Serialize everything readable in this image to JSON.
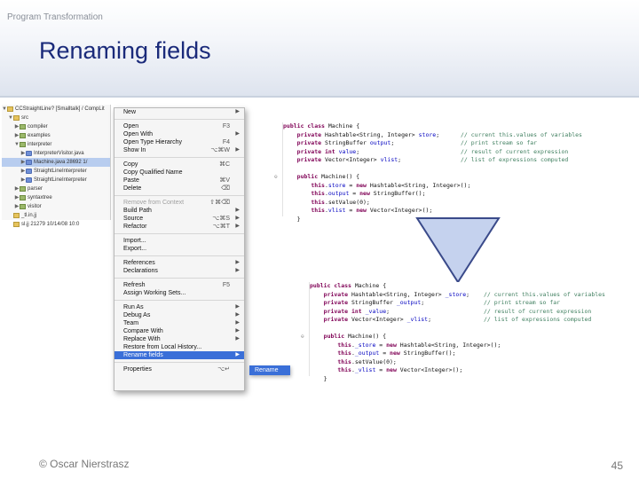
{
  "slide": {
    "course_label": "Program Transformation",
    "title": "Renaming fields",
    "copyright": "© Oscar Nierstrasz",
    "page_number": "45"
  },
  "explorer": {
    "items": [
      {
        "label": "CCStraightLine? [Smalltalk] / CompLit",
        "indent": 0,
        "twisty": "▼",
        "icon": "folder-icon",
        "selected": false
      },
      {
        "label": "src",
        "indent": 1,
        "twisty": "▼",
        "icon": "folder-icon",
        "selected": false
      },
      {
        "label": "compiler",
        "indent": 2,
        "twisty": "▶",
        "icon": "package-icon",
        "selected": false
      },
      {
        "label": "examples",
        "indent": 2,
        "twisty": "▶",
        "icon": "package-icon",
        "selected": false
      },
      {
        "label": "interpreter",
        "indent": 2,
        "twisty": "▼",
        "icon": "package-icon",
        "selected": false
      },
      {
        "label": "InterpreterVisitor.java",
        "indent": 3,
        "twisty": "▶",
        "icon": "java-file-icon",
        "selected": false
      },
      {
        "label": "Machine.java 28692 1/",
        "indent": 3,
        "twisty": "▶",
        "icon": "java-file-icon",
        "selected": true
      },
      {
        "label": "StraightLineInterpreter",
        "indent": 3,
        "twisty": "▶",
        "icon": "java-file-icon",
        "selected": false
      },
      {
        "label": "StraightLineInterpreter",
        "indent": 3,
        "twisty": "▶",
        "icon": "java-file-icon",
        "selected": false
      },
      {
        "label": "parser",
        "indent": 2,
        "twisty": "▶",
        "icon": "package-icon",
        "selected": false
      },
      {
        "label": "syntaxtree",
        "indent": 2,
        "twisty": "▶",
        "icon": "package-icon",
        "selected": false
      },
      {
        "label": "visitor",
        "indent": 2,
        "twisty": "▶",
        "icon": "package-icon",
        "selected": false
      },
      {
        "label": "_tl.in.jj",
        "indent": 1,
        "twisty": "",
        "icon": "file-icon",
        "selected": false
      },
      {
        "label": "sl.jj 21279 10/14/08 10:0",
        "indent": 1,
        "twisty": "",
        "icon": "file-icon",
        "selected": false
      }
    ]
  },
  "context_menu": {
    "items": [
      {
        "type": "item",
        "label": "New",
        "shortcut": "",
        "arrow": true,
        "highlight": false,
        "disabled": false
      },
      {
        "type": "sep"
      },
      {
        "type": "item",
        "label": "Open",
        "shortcut": "F3",
        "arrow": false,
        "highlight": false,
        "disabled": false
      },
      {
        "type": "item",
        "label": "Open With",
        "shortcut": "",
        "arrow": true,
        "highlight": false,
        "disabled": false
      },
      {
        "type": "item",
        "label": "Open Type Hierarchy",
        "shortcut": "F4",
        "arrow": false,
        "highlight": false,
        "disabled": false
      },
      {
        "type": "item",
        "label": "Show In",
        "shortcut": "⌥⌘W",
        "arrow": true,
        "highlight": false,
        "disabled": false
      },
      {
        "type": "sep"
      },
      {
        "type": "item",
        "label": "Copy",
        "shortcut": "⌘C",
        "arrow": false,
        "highlight": false,
        "disabled": false
      },
      {
        "type": "item",
        "label": "Copy Qualified Name",
        "shortcut": "",
        "arrow": false,
        "highlight": false,
        "disabled": false
      },
      {
        "type": "item",
        "label": "Paste",
        "shortcut": "⌘V",
        "arrow": false,
        "highlight": false,
        "disabled": false
      },
      {
        "type": "item",
        "label": "Delete",
        "shortcut": "⌫",
        "arrow": false,
        "highlight": false,
        "disabled": false
      },
      {
        "type": "sep"
      },
      {
        "type": "item",
        "label": "Remove from Context",
        "shortcut": "⇧⌘⌫",
        "arrow": false,
        "highlight": false,
        "disabled": true
      },
      {
        "type": "item",
        "label": "Build Path",
        "shortcut": "",
        "arrow": true,
        "highlight": false,
        "disabled": false
      },
      {
        "type": "item",
        "label": "Source",
        "shortcut": "⌥⌘S",
        "arrow": true,
        "highlight": false,
        "disabled": false
      },
      {
        "type": "item",
        "label": "Refactor",
        "shortcut": "⌥⌘T",
        "arrow": true,
        "highlight": false,
        "disabled": false
      },
      {
        "type": "sep"
      },
      {
        "type": "item",
        "label": "Import...",
        "shortcut": "",
        "arrow": false,
        "highlight": false,
        "disabled": false
      },
      {
        "type": "item",
        "label": "Export...",
        "shortcut": "",
        "arrow": false,
        "highlight": false,
        "disabled": false
      },
      {
        "type": "sep"
      },
      {
        "type": "item",
        "label": "References",
        "shortcut": "",
        "arrow": true,
        "highlight": false,
        "disabled": false
      },
      {
        "type": "item",
        "label": "Declarations",
        "shortcut": "",
        "arrow": true,
        "highlight": false,
        "disabled": false
      },
      {
        "type": "sep"
      },
      {
        "type": "item",
        "label": "Refresh",
        "shortcut": "F5",
        "arrow": false,
        "highlight": false,
        "disabled": false
      },
      {
        "type": "item",
        "label": "Assign Working Sets...",
        "shortcut": "",
        "arrow": false,
        "highlight": false,
        "disabled": false
      },
      {
        "type": "sep"
      },
      {
        "type": "item",
        "label": "Run As",
        "shortcut": "",
        "arrow": true,
        "highlight": false,
        "disabled": false
      },
      {
        "type": "item",
        "label": "Debug As",
        "shortcut": "",
        "arrow": true,
        "highlight": false,
        "disabled": false
      },
      {
        "type": "item",
        "label": "Team",
        "shortcut": "",
        "arrow": true,
        "highlight": false,
        "disabled": false
      },
      {
        "type": "item",
        "label": "Compare With",
        "shortcut": "",
        "arrow": true,
        "highlight": false,
        "disabled": false
      },
      {
        "type": "item",
        "label": "Replace With",
        "shortcut": "",
        "arrow": true,
        "highlight": false,
        "disabled": false
      },
      {
        "type": "item",
        "label": "Restore from Local History...",
        "shortcut": "",
        "arrow": false,
        "highlight": false,
        "disabled": false
      },
      {
        "type": "item",
        "label": "Rename fields",
        "shortcut": "",
        "arrow": true,
        "highlight": true,
        "disabled": false
      },
      {
        "type": "sep"
      },
      {
        "type": "item",
        "label": "Properties",
        "shortcut": "⌥↵",
        "arrow": false,
        "highlight": false,
        "disabled": false
      }
    ]
  },
  "submenu": {
    "label": "Rename"
  },
  "code_before": {
    "lines": [
      {
        "parts": [
          [
            "kw",
            "public class"
          ],
          [
            "t",
            " Machine {"
          ]
        ],
        "comment": "",
        "fold": ""
      },
      {
        "parts": [
          [
            "t",
            "    "
          ],
          [
            "kw",
            "private"
          ],
          [
            "t",
            " Hashtable<String, Integer> "
          ],
          [
            "fld",
            "store"
          ],
          [
            "t",
            ";"
          ]
        ],
        "comment": "// current this.values of variables",
        "fold": ""
      },
      {
        "parts": [
          [
            "t",
            "    "
          ],
          [
            "kw",
            "private"
          ],
          [
            "t",
            " StringBuffer "
          ],
          [
            "fld",
            "output"
          ],
          [
            "t",
            ";"
          ]
        ],
        "comment": "// print stream so far",
        "fold": ""
      },
      {
        "parts": [
          [
            "t",
            "    "
          ],
          [
            "kw",
            "private int"
          ],
          [
            "t",
            " "
          ],
          [
            "fld",
            "value"
          ],
          [
            "t",
            ";"
          ]
        ],
        "comment": "// result of current expression",
        "fold": ""
      },
      {
        "parts": [
          [
            "t",
            "    "
          ],
          [
            "kw",
            "private"
          ],
          [
            "t",
            " Vector<Integer> "
          ],
          [
            "fld",
            "vlist"
          ],
          [
            "t",
            ";"
          ]
        ],
        "comment": "// list of expressions computed",
        "fold": ""
      },
      {
        "parts": [
          [
            "t",
            ""
          ]
        ],
        "comment": "",
        "fold": ""
      },
      {
        "parts": [
          [
            "t",
            "    "
          ],
          [
            "kw",
            "public"
          ],
          [
            "t",
            " Machine() {"
          ]
        ],
        "comment": "",
        "fold": "⊖"
      },
      {
        "parts": [
          [
            "t",
            "        "
          ],
          [
            "kw",
            "this"
          ],
          [
            "t",
            "."
          ],
          [
            "fld",
            "store"
          ],
          [
            "t",
            " = "
          ],
          [
            "kw",
            "new"
          ],
          [
            "t",
            " Hashtable<String, Integer>();"
          ]
        ],
        "comment": "",
        "fold": ""
      },
      {
        "parts": [
          [
            "t",
            "        "
          ],
          [
            "kw",
            "this"
          ],
          [
            "t",
            "."
          ],
          [
            "fld",
            "output"
          ],
          [
            "t",
            " = "
          ],
          [
            "kw",
            "new"
          ],
          [
            "t",
            " StringBuffer();"
          ]
        ],
        "comment": "",
        "fold": ""
      },
      {
        "parts": [
          [
            "t",
            "        "
          ],
          [
            "kw",
            "this"
          ],
          [
            "t",
            ".setValue(0);"
          ]
        ],
        "comment": "",
        "fold": ""
      },
      {
        "parts": [
          [
            "t",
            "        "
          ],
          [
            "kw",
            "this"
          ],
          [
            "t",
            "."
          ],
          [
            "fld",
            "vlist"
          ],
          [
            "t",
            " = "
          ],
          [
            "kw",
            "new"
          ],
          [
            "t",
            " Vector<Integer>();"
          ]
        ],
        "comment": "",
        "fold": ""
      },
      {
        "parts": [
          [
            "t",
            "    }"
          ]
        ],
        "comment": "",
        "fold": ""
      }
    ]
  },
  "code_after": {
    "lines": [
      {
        "parts": [
          [
            "kw",
            "public class"
          ],
          [
            "t",
            " Machine {"
          ]
        ],
        "comment": "",
        "fold": ""
      },
      {
        "parts": [
          [
            "t",
            "    "
          ],
          [
            "kw",
            "private"
          ],
          [
            "t",
            " Hashtable<String, Integer> "
          ],
          [
            "fld",
            "_store"
          ],
          [
            "t",
            ";"
          ]
        ],
        "comment": "// current this.values of variables",
        "fold": ""
      },
      {
        "parts": [
          [
            "t",
            "    "
          ],
          [
            "kw",
            "private"
          ],
          [
            "t",
            " StringBuffer "
          ],
          [
            "fld",
            "_output"
          ],
          [
            "t",
            ";"
          ]
        ],
        "comment": "// print stream so far",
        "fold": ""
      },
      {
        "parts": [
          [
            "t",
            "    "
          ],
          [
            "kw",
            "private int"
          ],
          [
            "t",
            " "
          ],
          [
            "fld",
            "_value"
          ],
          [
            "t",
            ";"
          ]
        ],
        "comment": "// result of current expression",
        "fold": ""
      },
      {
        "parts": [
          [
            "t",
            "    "
          ],
          [
            "kw",
            "private"
          ],
          [
            "t",
            " Vector<Integer> "
          ],
          [
            "fld",
            "_vlist"
          ],
          [
            "t",
            ";"
          ]
        ],
        "comment": "// list of expressions computed",
        "fold": ""
      },
      {
        "parts": [
          [
            "t",
            ""
          ]
        ],
        "comment": "",
        "fold": ""
      },
      {
        "parts": [
          [
            "t",
            "    "
          ],
          [
            "kw",
            "public"
          ],
          [
            "t",
            " Machine() {"
          ]
        ],
        "comment": "",
        "fold": "⊖"
      },
      {
        "parts": [
          [
            "t",
            "        "
          ],
          [
            "kw",
            "this"
          ],
          [
            "t",
            "."
          ],
          [
            "fld",
            "_store"
          ],
          [
            "t",
            " = "
          ],
          [
            "kw",
            "new"
          ],
          [
            "t",
            " Hashtable<String, Integer>();"
          ]
        ],
        "comment": "",
        "fold": ""
      },
      {
        "parts": [
          [
            "t",
            "        "
          ],
          [
            "kw",
            "this"
          ],
          [
            "t",
            "."
          ],
          [
            "fld",
            "_output"
          ],
          [
            "t",
            " = "
          ],
          [
            "kw",
            "new"
          ],
          [
            "t",
            " StringBuffer();"
          ]
        ],
        "comment": "",
        "fold": ""
      },
      {
        "parts": [
          [
            "t",
            "        "
          ],
          [
            "kw",
            "this"
          ],
          [
            "t",
            ".setValue(0);"
          ]
        ],
        "comment": "",
        "fold": ""
      },
      {
        "parts": [
          [
            "t",
            "        "
          ],
          [
            "kw",
            "this"
          ],
          [
            "t",
            "."
          ],
          [
            "fld",
            "_vlist"
          ],
          [
            "t",
            " = "
          ],
          [
            "kw",
            "new"
          ],
          [
            "t",
            " Vector<Integer>();"
          ]
        ],
        "comment": "",
        "fold": ""
      },
      {
        "parts": [
          [
            "t",
            "    }"
          ]
        ],
        "comment": "",
        "fold": ""
      }
    ]
  },
  "colors": {
    "title": "#1a2a7a",
    "menu_highlight": "#3a6fd8",
    "keyword": "#7f0055",
    "field": "#0000c0",
    "comment": "#3f7f5f",
    "arrow_fill": "#c5d2ee",
    "arrow_stroke": "#3a4a8a"
  }
}
